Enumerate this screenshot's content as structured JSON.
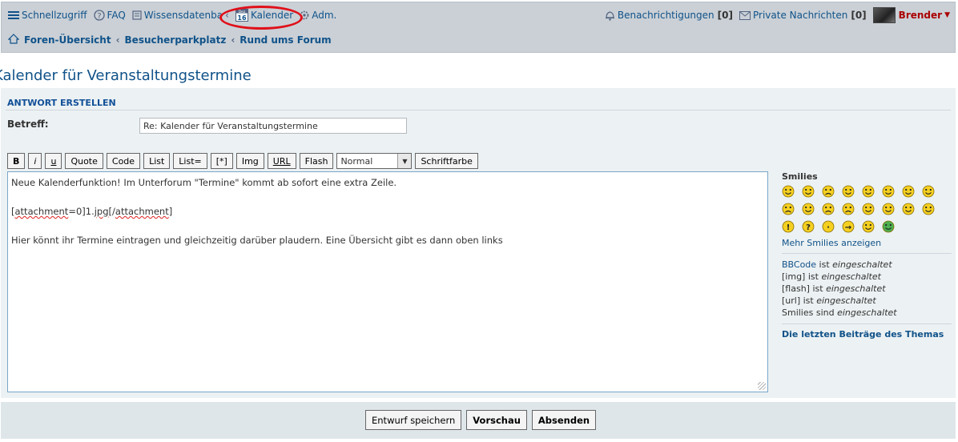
{
  "nav": {
    "quick_access": "Schnellzugriff",
    "faq": "FAQ",
    "knowledge_base": "Wissensdatenba",
    "calendar": "Kalender",
    "calendar_icon_top": "Dez",
    "calendar_icon_day": "16",
    "admin": "Adm.",
    "notifications": "Benachrichtigungen",
    "notifications_count": "[0]",
    "private_messages": "Private Nachrichten",
    "pm_count": "[0]",
    "username": "Brender",
    "user_caret": "▼"
  },
  "breadcrumbs": [
    "Foren-Übersicht",
    "Besucherparkplatz",
    "Rund ums Forum"
  ],
  "breadcrumb_sep": "‹",
  "page_title": "Kalender für Veranstaltungstermine",
  "form": {
    "header": "ANTWORT ERSTELLEN",
    "subject_label": "Betreff:",
    "subject_value": "Re: Kalender für Veranstaltungstermine"
  },
  "toolbar": {
    "bold": "B",
    "italic": "i",
    "underline": "u",
    "quote": "Quote",
    "code": "Code",
    "list": "List",
    "list_num": "List=",
    "list_item": "[*]",
    "img": "Img",
    "url": "URL",
    "flash": "Flash",
    "font_size": "Normal",
    "font_color": "Schriftfarbe"
  },
  "message": {
    "line1": "Neue Kalenderfunktion! Im Unterforum \"Termine\" kommt ab sofort eine extra Zeile.",
    "line2_a": "[",
    "line2_b": "attachment",
    "line2_c": "=0]1.",
    "line2_d": "jpg",
    "line2_e": "[/",
    "line2_f": "attachment",
    "line2_g": "]",
    "line3": "Hier könnt ihr Termine eintragen und gleichzeitig darüber plaudern. Eine Übersicht gibt es dann oben links"
  },
  "sidebar": {
    "smilies_title": "Smilies",
    "more_smilies": "Mehr Smilies anzeigen",
    "bbcode_link": "BBCode",
    "bbcode_rest": " ist ",
    "img_label": "[img] ist ",
    "flash_label": "[flash] ist ",
    "url_label": "[url] ist ",
    "smilies_label": "Smilies sind ",
    "enabled": "eingeschaltet",
    "recent_posts": "Die letzten Beiträge des Themas"
  },
  "footer": {
    "save_draft": "Entwurf speichern",
    "preview": "Vorschau",
    "submit": "Absenden"
  },
  "colors": {
    "link": "#105289",
    "highlight_ring": "#e0101a",
    "username": "#aa0000"
  }
}
